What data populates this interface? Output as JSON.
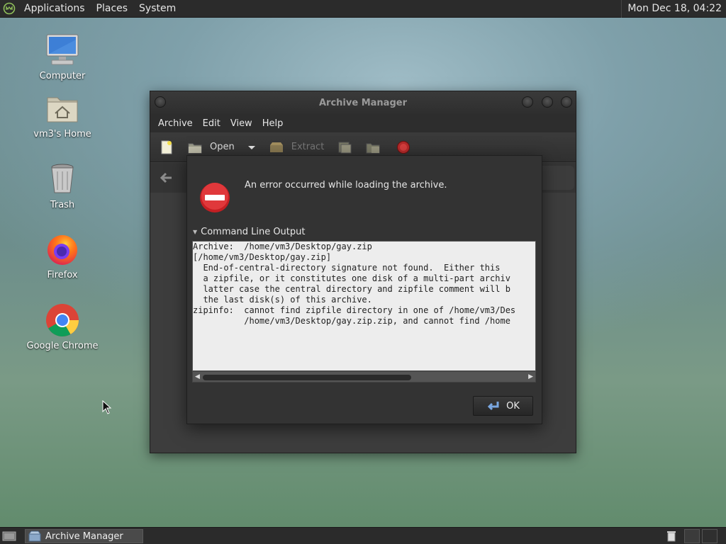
{
  "top_panel": {
    "menus": [
      "Applications",
      "Places",
      "System"
    ],
    "clock": "Mon Dec 18, 04:22"
  },
  "desktop_icons": [
    {
      "label": "Computer",
      "icon": "computer-icon"
    },
    {
      "label": "vm3's Home",
      "icon": "home-folder-icon"
    },
    {
      "label": "Trash",
      "icon": "trash-icon"
    },
    {
      "label": "Firefox",
      "icon": "firefox-icon"
    },
    {
      "label": "Google Chrome",
      "icon": "chrome-icon"
    }
  ],
  "window": {
    "title": "Archive Manager",
    "menus": [
      "Archive",
      "Edit",
      "View",
      "Help"
    ],
    "toolbar": {
      "open_label": "Open",
      "extract_label": "Extract"
    }
  },
  "dialog": {
    "message": "An error occurred while loading the archive.",
    "expander_label": "Command Line Output",
    "output_lines": [
      "Archive:  /home/vm3/Desktop/gay.zip",
      "[/home/vm3/Desktop/gay.zip]",
      "  End-of-central-directory signature not found.  Either this",
      "  a zipfile, or it constitutes one disk of a multi-part archiv",
      "  latter case the central directory and zipfile comment will b",
      "  the last disk(s) of this archive.",
      "zipinfo:  cannot find zipfile directory in one of /home/vm3/Des",
      "          /home/vm3/Desktop/gay.zip.zip, and cannot find /home"
    ],
    "ok_label": "OK"
  },
  "bottom_panel": {
    "task_label": "Archive Manager"
  },
  "colors": {
    "panel": "#2b2b2b",
    "error_red": "#d8262a",
    "dialog_bg": "#333333"
  }
}
